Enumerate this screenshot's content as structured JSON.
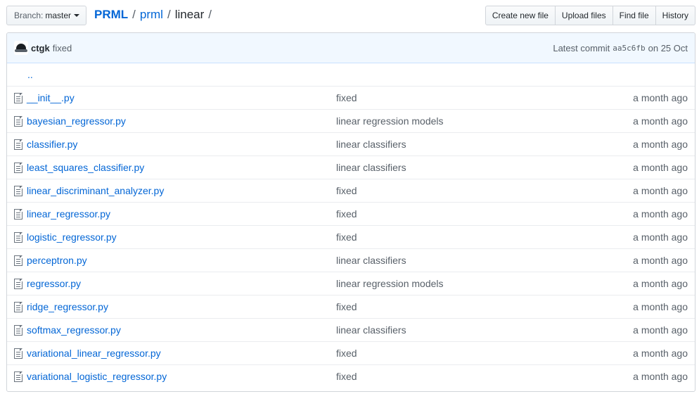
{
  "branch": {
    "prefix": "Branch:",
    "name": "master"
  },
  "breadcrumb": {
    "root": "PRML",
    "path": "prml",
    "current": "linear",
    "sep": "/"
  },
  "actions": {
    "create_new_file": "Create new file",
    "upload_files": "Upload files",
    "find_file": "Find file",
    "history": "History"
  },
  "commit": {
    "author": "ctgk",
    "message": "fixed",
    "latest_label": "Latest commit",
    "sha": "aa5c6fb",
    "date_label": "on 25 Oct"
  },
  "parent_link": "..",
  "files": [
    {
      "name": "__init__.py",
      "message": "fixed",
      "age": "a month ago"
    },
    {
      "name": "bayesian_regressor.py",
      "message": "linear regression models",
      "age": "a month ago"
    },
    {
      "name": "classifier.py",
      "message": "linear classifiers",
      "age": "a month ago"
    },
    {
      "name": "least_squares_classifier.py",
      "message": "linear classifiers",
      "age": "a month ago"
    },
    {
      "name": "linear_discriminant_analyzer.py",
      "message": "fixed",
      "age": "a month ago"
    },
    {
      "name": "linear_regressor.py",
      "message": "fixed",
      "age": "a month ago"
    },
    {
      "name": "logistic_regressor.py",
      "message": "fixed",
      "age": "a month ago"
    },
    {
      "name": "perceptron.py",
      "message": "linear classifiers",
      "age": "a month ago"
    },
    {
      "name": "regressor.py",
      "message": "linear regression models",
      "age": "a month ago"
    },
    {
      "name": "ridge_regressor.py",
      "message": "fixed",
      "age": "a month ago"
    },
    {
      "name": "softmax_regressor.py",
      "message": "linear classifiers",
      "age": "a month ago"
    },
    {
      "name": "variational_linear_regressor.py",
      "message": "fixed",
      "age": "a month ago"
    },
    {
      "name": "variational_logistic_regressor.py",
      "message": "fixed",
      "age": "a month ago"
    }
  ],
  "icons": {
    "file": "file-text-icon",
    "caret": "caret-down-icon",
    "avatar": "hat-avatar"
  },
  "colors": {
    "link": "#0366d6",
    "muted": "#586069",
    "commit_bg": "#f1f8ff",
    "border": "#d1d5da"
  }
}
